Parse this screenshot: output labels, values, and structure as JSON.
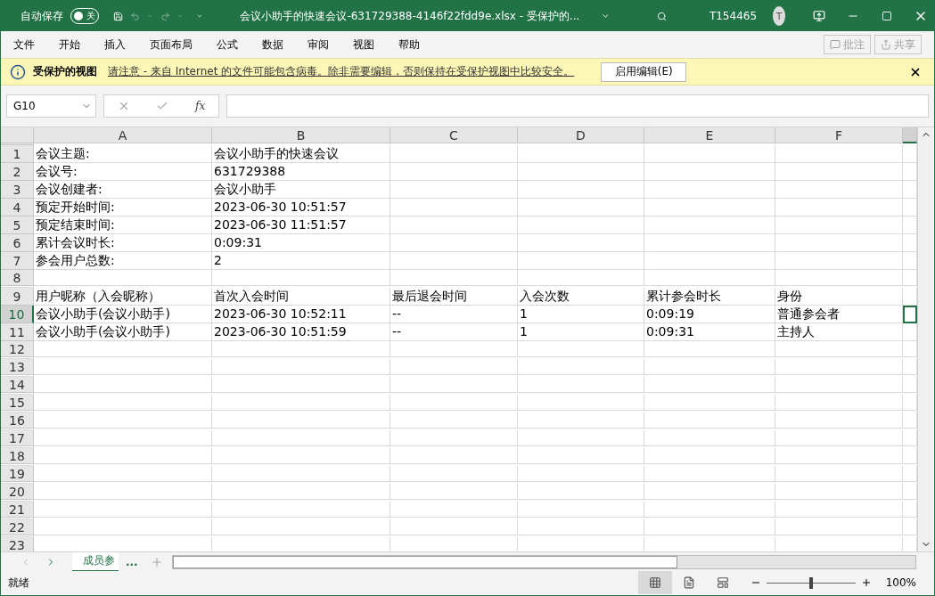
{
  "title_bar": {
    "autosave_label": "自动保存",
    "autosave_toggle": {
      "label": "关",
      "on": false
    },
    "title": "会议小助手的快速会议-631729388-4146f22fdd9e.xlsx  -  受保护的...",
    "user": "T154465",
    "avatar_initial": "T"
  },
  "menu": {
    "items": [
      "文件",
      "开始",
      "插入",
      "页面布局",
      "公式",
      "数据",
      "审阅",
      "视图",
      "帮助"
    ],
    "buttons": [
      {
        "label": "批注",
        "disabled": true
      },
      {
        "label": "共享",
        "disabled": true
      }
    ]
  },
  "protected_bar": {
    "title": "受保护的视图",
    "message": "请注意 - 来自 Internet 的文件可能包含病毒。除非需要编辑，否则保持在受保护视图中比较安全。",
    "button": "启用编辑(E)"
  },
  "formula_bar": {
    "name_box": "G10",
    "function_label": "fx"
  },
  "sheet": {
    "columns": [
      "A",
      "B",
      "C",
      "D",
      "E",
      "F"
    ],
    "rows": [
      {
        "number": "1",
        "selected": false,
        "cells": [
          "会议主题:",
          "会议小助手的快速会议"
        ]
      },
      {
        "number": "2",
        "selected": false,
        "cells": [
          "会议号:",
          "631729388"
        ]
      },
      {
        "number": "3",
        "selected": false,
        "cells": [
          "会议创建者:",
          "会议小助手"
        ]
      },
      {
        "number": "4",
        "selected": false,
        "cells": [
          "预定开始时间:",
          "2023-06-30 10:51:57"
        ]
      },
      {
        "number": "5",
        "selected": false,
        "cells": [
          "预定结束时间:",
          "2023-06-30 11:51:57"
        ]
      },
      {
        "number": "6",
        "selected": false,
        "cells": [
          "累计会议时长:",
          "0:09:31"
        ]
      },
      {
        "number": "7",
        "selected": false,
        "cells": [
          "参会用户总数:",
          "2"
        ]
      },
      {
        "number": "8",
        "selected": false
      },
      {
        "number": "9",
        "selected": false,
        "cells": [
          "用户昵称（入会昵称）",
          "首次入会时间",
          "最后退会时间",
          "入会次数",
          "累计参会时长",
          "身份"
        ]
      },
      {
        "number": "10",
        "selected": true,
        "cells": [
          "会议小助手(会议小助手)",
          "2023-06-30 10:52:11",
          "--",
          "1",
          "0:09:19",
          "普通参会者"
        ]
      },
      {
        "number": "11",
        "selected": false,
        "cells": [
          "会议小助手(会议小助手)",
          "2023-06-30 10:51:59",
          "--",
          "1",
          "0:09:31",
          "主持人"
        ]
      },
      {
        "number": "12",
        "selected": false
      },
      {
        "number": "13",
        "selected": false
      },
      {
        "number": "14",
        "selected": false
      },
      {
        "number": "15",
        "selected": false
      },
      {
        "number": "16",
        "selected": false
      },
      {
        "number": "17",
        "selected": false
      },
      {
        "number": "18",
        "selected": false
      },
      {
        "number": "19",
        "selected": false
      },
      {
        "number": "20",
        "selected": false
      },
      {
        "number": "21",
        "selected": false
      },
      {
        "number": "22",
        "selected": false
      },
      {
        "number": "23",
        "selected": false
      }
    ]
  },
  "sheet_tabs": {
    "tabs": [
      {
        "label": "成员参",
        "selected": true
      }
    ],
    "more": "..."
  },
  "status_bar": {
    "status": "就绪",
    "views": [
      {
        "kind": "normal",
        "selected": true
      },
      {
        "kind": "page_layout",
        "selected": false
      },
      {
        "kind": "page_break",
        "selected": false
      }
    ],
    "zoom": {
      "level": 0.5,
      "label": "100%"
    }
  }
}
